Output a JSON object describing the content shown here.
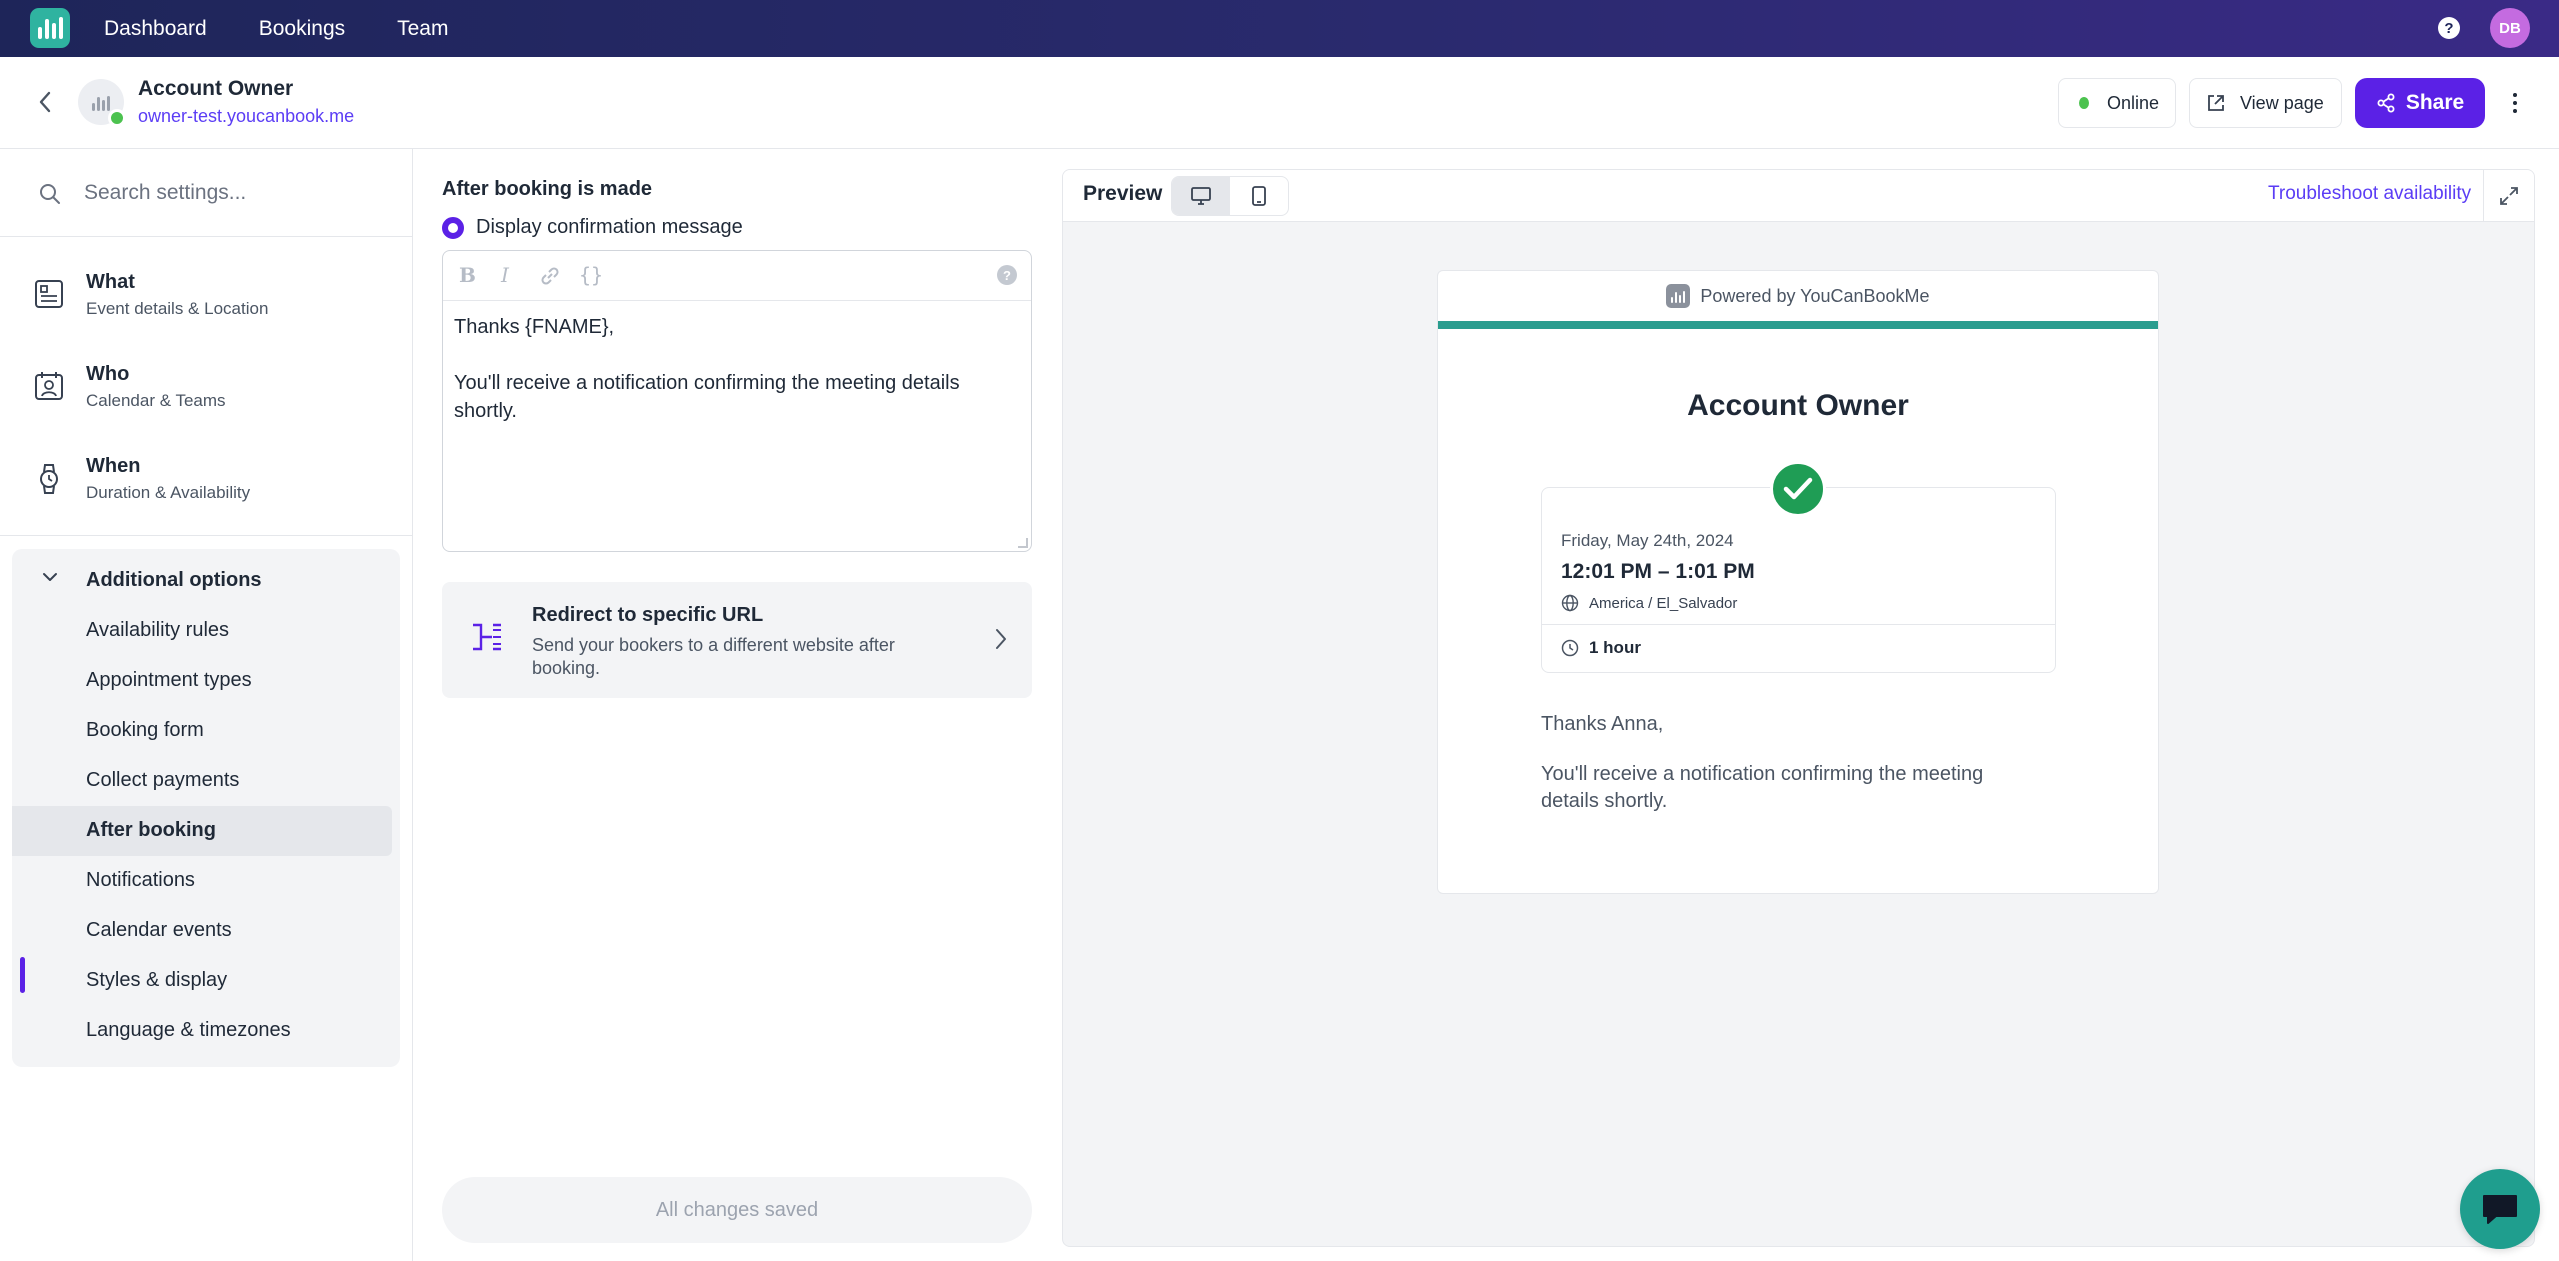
{
  "topnav": {
    "links": [
      "Dashboard",
      "Bookings",
      "Team"
    ],
    "user_initials": "DB"
  },
  "header": {
    "title": "Account Owner",
    "url": "owner-test.youcanbook.me",
    "status_label": "Online",
    "view_page_label": "View page",
    "share_label": "Share"
  },
  "sidebar": {
    "search_placeholder": "Search settings...",
    "main_items": [
      {
        "title": "What",
        "subtitle": "Event details & Location"
      },
      {
        "title": "Who",
        "subtitle": "Calendar & Teams"
      },
      {
        "title": "When",
        "subtitle": "Duration & Availability"
      }
    ],
    "options_title": "Additional options",
    "options": [
      "Availability rules",
      "Appointment types",
      "Booking form",
      "Collect payments",
      "After booking",
      "Notifications",
      "Calendar events",
      "Styles & display",
      "Language & timezones"
    ],
    "active_option": "After booking"
  },
  "settings": {
    "section_title": "After booking is made",
    "radio_label": "Display confirmation message",
    "toolbar": {
      "bold": "B",
      "italic": "I",
      "braces": "{}",
      "help": "?"
    },
    "message_lines": [
      "Thanks {FNAME},",
      "You'll receive a notification confirming the meeting details shortly."
    ],
    "redirect": {
      "title": "Redirect to specific URL",
      "subtitle": "Send your bookers to a different website after booking."
    },
    "save_status": "All changes saved"
  },
  "preview": {
    "label": "Preview",
    "troubleshoot_label": "Troubleshoot availability",
    "powered_by": "Powered by YouCanBookMe",
    "card_title": "Account Owner",
    "date": "Friday, May 24th, 2024",
    "time": "12:01 PM – 1:01 PM",
    "timezone": "America / El_Salvador",
    "duration": "1 hour",
    "thanks": "Thanks Anna,",
    "message": "You'll receive a notification confirming the meeting details shortly."
  },
  "colors": {
    "accent": "#5b21e6",
    "teal": "#2a9d8f",
    "online": "#4cc24f",
    "success": "#1f9d55"
  }
}
